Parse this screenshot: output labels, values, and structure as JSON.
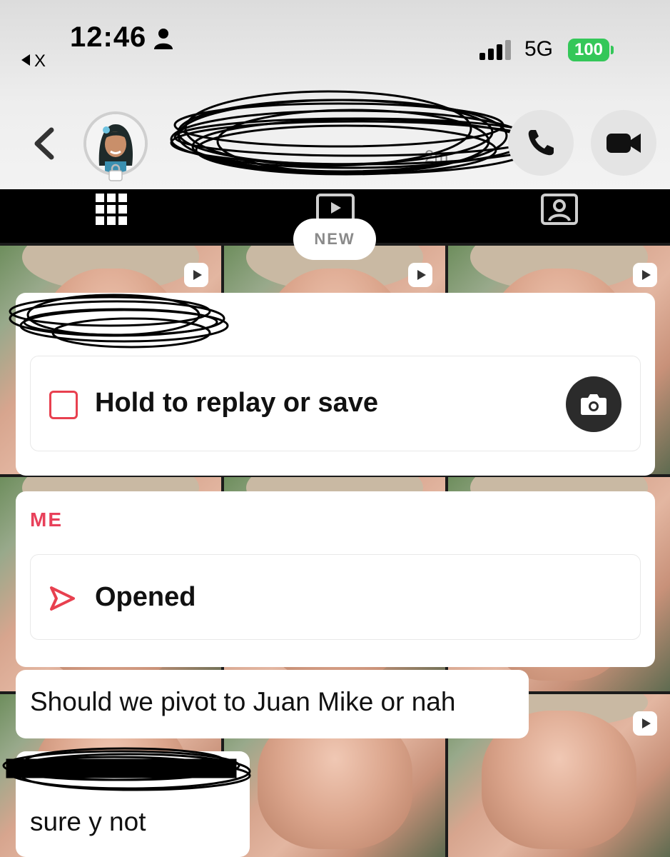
{
  "status_bar": {
    "time": "12:46",
    "back_app": "X",
    "network": "5G",
    "battery": "100"
  },
  "chat_header": {
    "subtitle": "2m",
    "call_icon": "phone-icon",
    "video_icon": "video-camera-icon"
  },
  "tabs": [
    {
      "name": "grid-icon"
    },
    {
      "name": "stories-icon"
    },
    {
      "name": "profile-icon"
    }
  ],
  "new_badge": "NEW",
  "messages": {
    "snap_received": {
      "label": "Hold to replay or save",
      "icon": "camera-icon"
    },
    "me_label": "ME",
    "snap_sent": {
      "label": "Opened",
      "icon": "sent-arrow-icon"
    },
    "text_sent": "Should we pivot to Juan Mike or nah",
    "text_received": "sure y not"
  },
  "colors": {
    "accent_red": "#e8405a",
    "battery_green": "#34c759",
    "dark_button": "#2b2b2b"
  }
}
